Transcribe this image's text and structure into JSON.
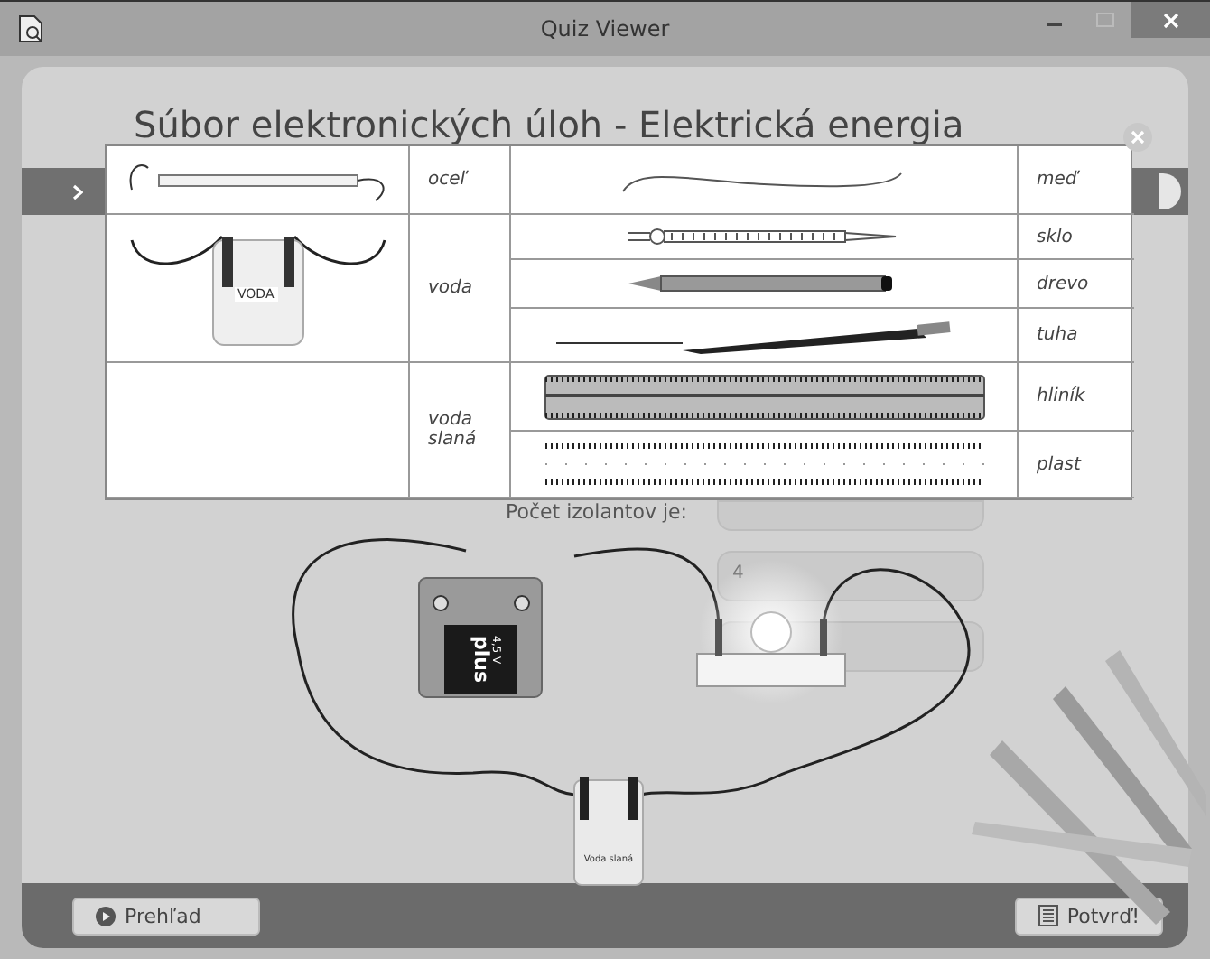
{
  "window": {
    "title": "Quiz Viewer"
  },
  "page": {
    "title": "Súbor elektronických úloh - Elektrická energia"
  },
  "materials_table": {
    "groups": [
      {
        "kind": "meter",
        "label": "oceľ",
        "materials": [
          {
            "kind": "wire",
            "label": "meď"
          }
        ]
      },
      {
        "kind": "jar",
        "jar_label": "VODA",
        "label": "voda",
        "materials": [
          {
            "kind": "glass-rod",
            "label": "sklo"
          },
          {
            "kind": "pencil",
            "label": "drevo"
          },
          {
            "kind": "mech-pencil",
            "label": "tuha"
          }
        ]
      },
      {
        "kind": "blank",
        "label": "voda slaná",
        "materials": [
          {
            "kind": "ruler-metal",
            "label": "hliník"
          },
          {
            "kind": "ruler-plastic",
            "label": "plast"
          }
        ]
      }
    ]
  },
  "question": {
    "prompt": "Počet izolantov je:",
    "answer_fields": [
      {
        "kind": "blank"
      },
      {
        "kind": "filled",
        "value": "4"
      },
      {
        "kind": "blank"
      }
    ]
  },
  "circuit": {
    "battery_brand": "plus",
    "battery_voltage": "4,5 V",
    "jar_label": "Voda slaná",
    "bulb_lit": true
  },
  "footer": {
    "buttons": [
      {
        "kind": "overview",
        "label": "Prehľad"
      },
      {
        "kind": "confirm",
        "label": "Potvrď!"
      }
    ]
  }
}
